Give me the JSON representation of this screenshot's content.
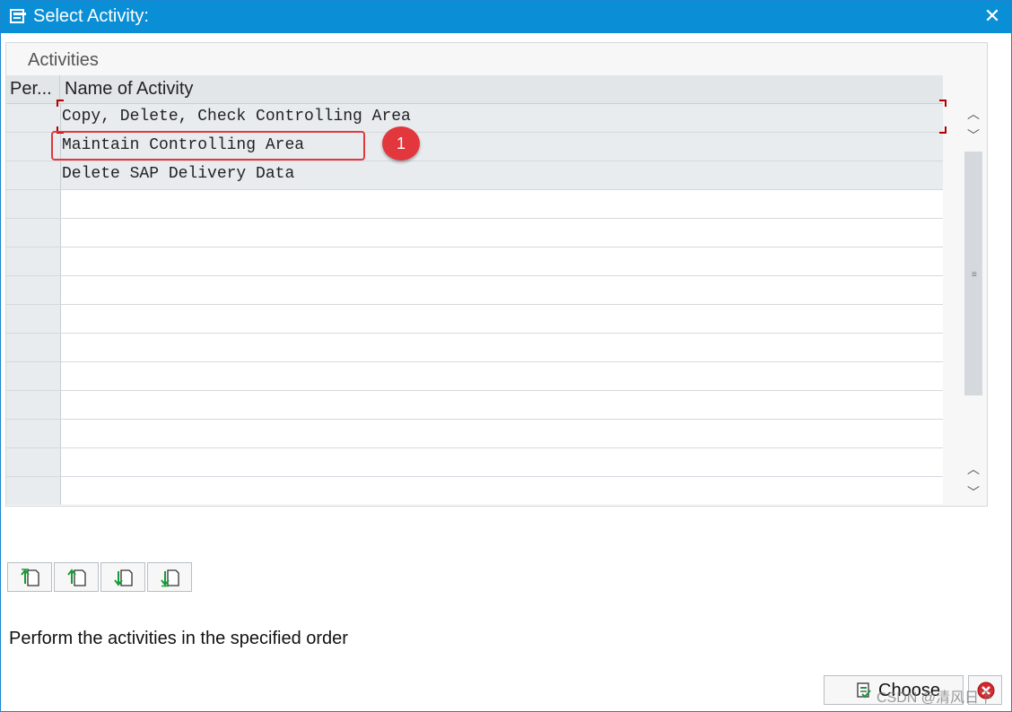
{
  "window": {
    "title": "Select Activity:",
    "close_glyph": "✕"
  },
  "panel": {
    "title": "Activities",
    "columns": {
      "perform": "Per...",
      "name": "Name of Activity"
    },
    "rows": [
      "Copy, Delete, Check Controlling Area",
      "Maintain Controlling Area",
      "Delete SAP Delivery Data"
    ]
  },
  "annotation": {
    "badge": "1",
    "color": "#e2373d"
  },
  "status": {
    "text": "Perform the activities in the specified order"
  },
  "buttons": {
    "choose": "Choose"
  },
  "watermark": "CSDN @清风日下",
  "icons": {
    "title": "activity-list-icon",
    "settings": "table-settings-icon",
    "toolbar": [
      "move-to-top-icon",
      "move-up-icon",
      "move-down-icon",
      "move-to-bottom-icon"
    ],
    "choose": "choose-check-icon",
    "cancel": "cancel-icon"
  },
  "colors": {
    "titlebar": "#0a8fd6",
    "accent_red": "#e0393e"
  }
}
